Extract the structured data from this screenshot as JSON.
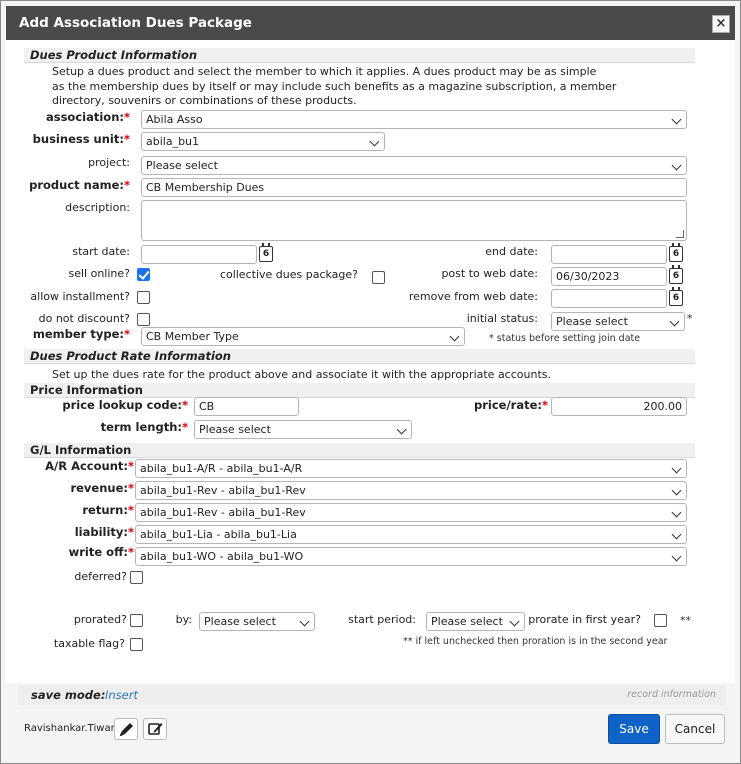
{
  "dialog": {
    "title": "Add Association Dues Package",
    "close": "×"
  },
  "sections": {
    "product_info": "Dues Product Information",
    "product_desc": [
      "Setup a dues product and select the member to which it applies. A dues product may be as simple",
      "as the membership dues by itself or may include such benefits as a magazine subscription, a member",
      "directory, souvenirs or combinations of these products."
    ],
    "rate_info": "Dues Product Rate Information",
    "rate_desc": "Set up the dues rate for the product above and associate it with the appropriate accounts.",
    "price_info": "Price Information",
    "gl_info": "G/L Information"
  },
  "labels": {
    "association": "association:",
    "business_unit": "business unit:",
    "project": "project:",
    "product_name": "product name:",
    "description": "description:",
    "start_date": "start date:",
    "end_date": "end date:",
    "sell_online": "sell online?",
    "collective": "collective dues package?",
    "post_to_web": "post to web date:",
    "allow_installment": "allow installment?",
    "remove_from_web": "remove from web date:",
    "do_not_discount": "do not discount?",
    "initial_status": "initial status:",
    "member_type": "member type:",
    "price_lookup": "price lookup code:",
    "price_rate": "price/rate:",
    "term_length": "term length:",
    "ar_account": "A/R Account:",
    "revenue": "revenue:",
    "return": "return:",
    "liability": "liability:",
    "write_off": "write off:",
    "deferred": "deferred?",
    "prorated": "prorated?",
    "by": "by:",
    "start_period": "start period:",
    "prorate_first_year": "prorate in first year?",
    "taxable": "taxable flag?"
  },
  "values": {
    "association": "Abila Asso",
    "business_unit": "abila_bu1",
    "project": "Please select",
    "product_name": "CB Membership Dues",
    "description": "",
    "start_date": "",
    "end_date": "",
    "post_to_web": "06/30/2023",
    "remove_from_web": "",
    "initial_status": "Please select",
    "member_type": "CB Member Type",
    "price_lookup": "CB",
    "price_rate": "200.00",
    "term_length": "Please select",
    "ar_account": "abila_bu1-A/R - abila_bu1-A/R",
    "revenue": "abila_bu1-Rev - abila_bu1-Rev",
    "return": "abila_bu1-Rev - abila_bu1-Rev",
    "liability": "abila_bu1-Lia - abila_bu1-Lia",
    "write_off": "abila_bu1-WO - abila_bu1-WO",
    "by": "Please select",
    "start_period": "Please select"
  },
  "checks": {
    "sell_online": true,
    "collective": false,
    "allow_installment": false,
    "do_not_discount": false,
    "deferred": false,
    "prorated": false,
    "prorate_first_year": false,
    "taxable": false
  },
  "notes": {
    "asterisk": "*",
    "status_before": "* status before setting join date",
    "double_star": "**",
    "left_unchecked": "** if left unchecked then proration is in the second year",
    "calendar_day": "6"
  },
  "footer": {
    "save_mode_label": "save mode:",
    "save_mode_value": "Insert",
    "record_info": "record information",
    "user": "Ravishankar.Tiwari",
    "save": "Save",
    "cancel": "Cancel"
  },
  "colors": {
    "accent": "#1a73e8",
    "save_button": "#0f62c6",
    "link": "#2a7ab8",
    "required": "#d9000d"
  }
}
